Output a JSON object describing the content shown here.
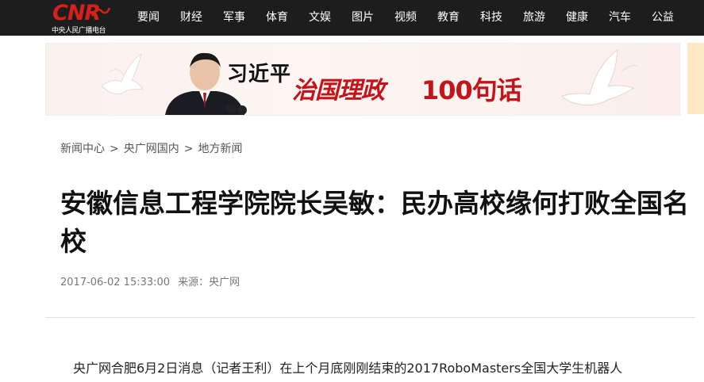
{
  "header": {
    "logo_text": "CNR",
    "logo_subtitle": "中央人民广播电台",
    "nav": [
      "要闻",
      "财经",
      "军事",
      "体育",
      "文娱",
      "图片",
      "视频",
      "教育",
      "科技",
      "旅游",
      "健康",
      "汽车",
      "公益"
    ]
  },
  "banner": {
    "name": "习近平",
    "slogan": "治国理政",
    "slogan_tail": "100句话"
  },
  "breadcrumb": [
    "新闻中心",
    "央广网国内",
    "地方新闻"
  ],
  "breadcrumb_sep": ">",
  "article": {
    "title": "安徽信息工程学院院长吴敏：民办高校缘何打败全国名校",
    "datetime": "2017-06-02 15:33:00",
    "source": "来源：央广网",
    "first_line": "央广网合肥6月2日消息（记者王利）在上个月底刚刚结束的2017RoboMasters全国大学生机器人"
  },
  "colors": {
    "topbar": "#1d1d1d",
    "brand_red": "#d6201a",
    "slogan_red": "#c4141b"
  }
}
